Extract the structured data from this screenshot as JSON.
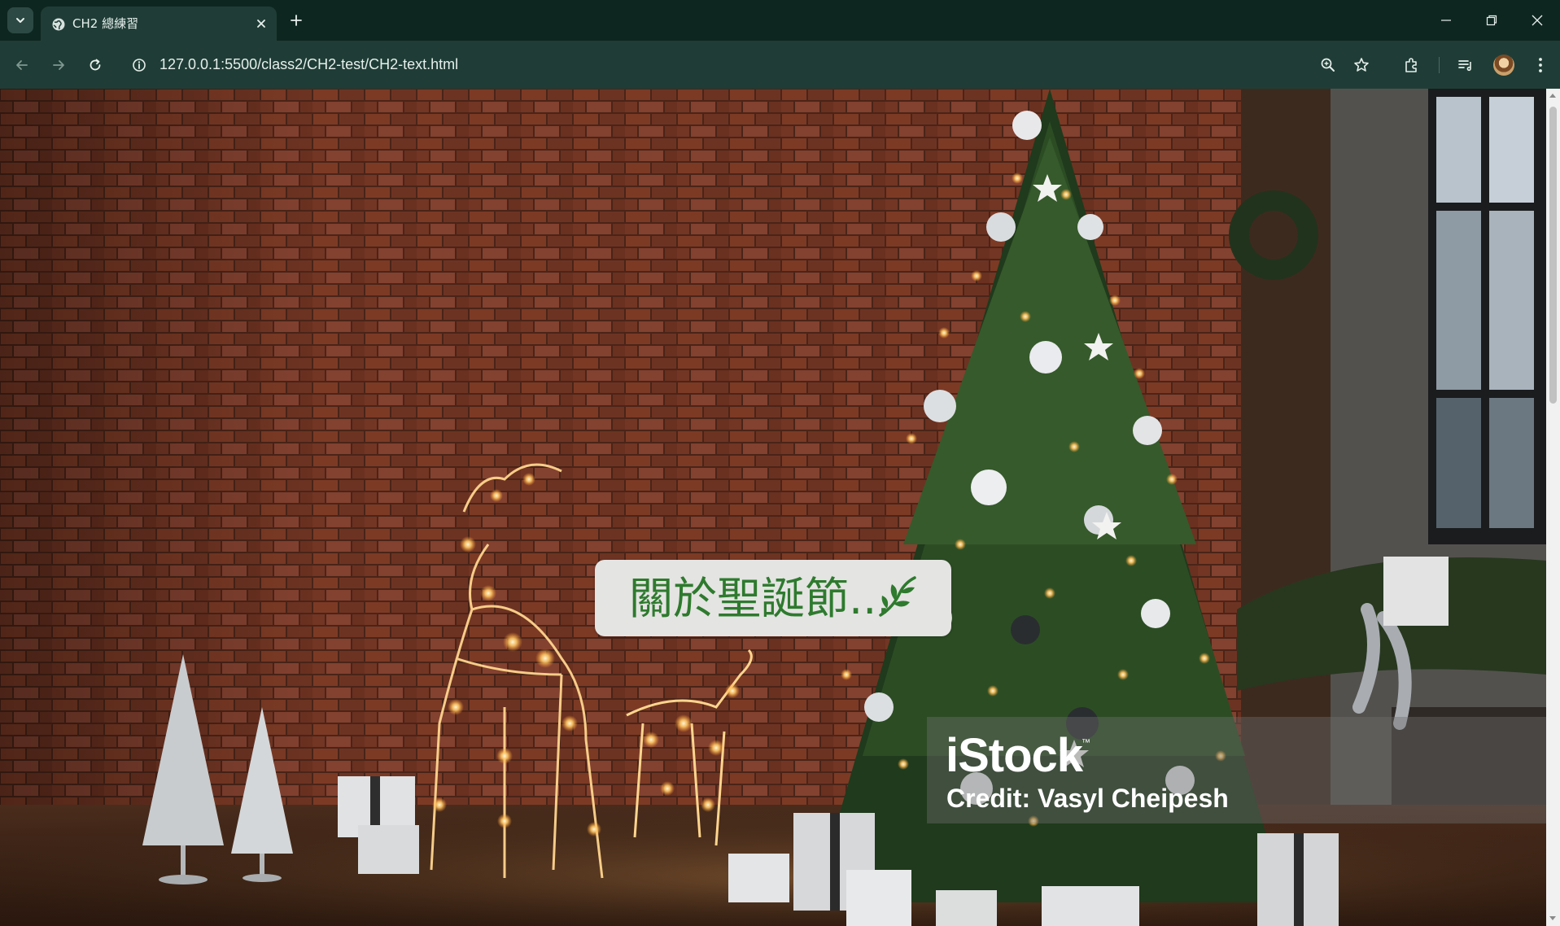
{
  "browser": {
    "tab": {
      "title": "CH2 總練習",
      "favicon": "globe-icon"
    },
    "address_bar": {
      "url": "127.0.0.1:5500/class2/CH2-test/CH2-text.html",
      "security_icon": "info-icon"
    },
    "toolbar_icons": [
      "back-icon",
      "forward-icon",
      "reload-icon",
      "zoom-icon",
      "bookmark-star-icon",
      "extensions-icon",
      "reading-list-icon",
      "profile-avatar",
      "menu-icon"
    ],
    "window_controls": [
      "minimize-icon",
      "restore-icon",
      "close-icon"
    ]
  },
  "page": {
    "heading": "關於聖誕節...",
    "heading_icon": "sprig-icon",
    "heading_color": "#2e7a2e",
    "heading_box_color": "#e4e4e2",
    "background_image": "christmas-room-photo",
    "watermark": {
      "logo": "iStock",
      "trademark": "™",
      "credit": "Credit: Vasyl Cheipesh"
    }
  },
  "colors": {
    "tabstrip": "#0e2620",
    "toolbar": "#1f3d36",
    "brick": "#7a3a26"
  }
}
